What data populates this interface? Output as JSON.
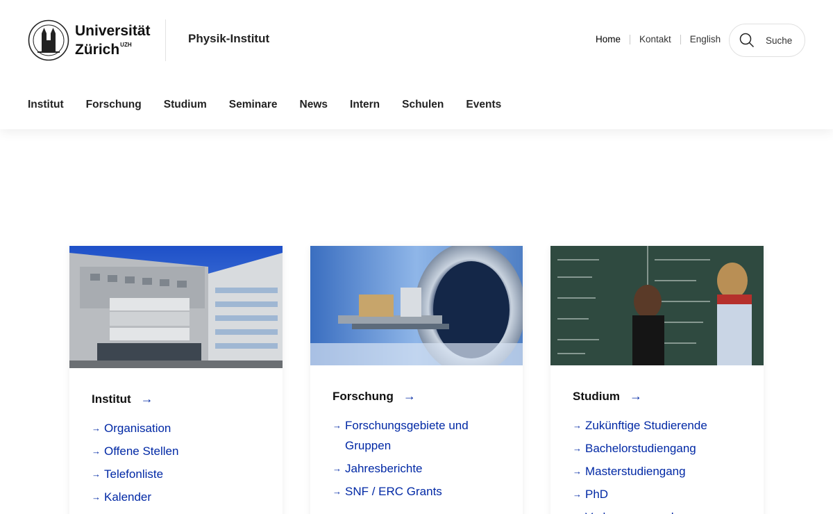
{
  "header": {
    "logo": {
      "line1": "Universität",
      "line2": "Zürich",
      "sup": "UZH"
    },
    "institute": "Physik-Institut",
    "service_links": [
      {
        "label": "Home",
        "active": true
      },
      {
        "label": "Kontakt"
      },
      {
        "label": "English"
      }
    ],
    "search_label": "Suche"
  },
  "nav": [
    "Institut",
    "Forschung",
    "Studium",
    "Seminare",
    "News",
    "Intern",
    "Schulen",
    "Events"
  ],
  "cards": [
    {
      "title": "Institut",
      "links": [
        "Organisation",
        "Offene Stellen",
        "Telefonliste",
        "Kalender"
      ]
    },
    {
      "title": "Forschung",
      "links": [
        "Forschungsgebiete und Gruppen",
        "Jahresberichte",
        "SNF / ERC Grants"
      ]
    },
    {
      "title": "Studium",
      "links": [
        "Zukünftige Studierende",
        "Bachelorstudiengang",
        "Masterstudiengang",
        "PhD",
        "Vorlesungen und"
      ]
    }
  ],
  "icons": {
    "search": "search-icon",
    "arrow": "arrow-right-icon",
    "seal": "university-seal-icon"
  },
  "colors": {
    "link": "#0028a5",
    "text": "#111111"
  }
}
